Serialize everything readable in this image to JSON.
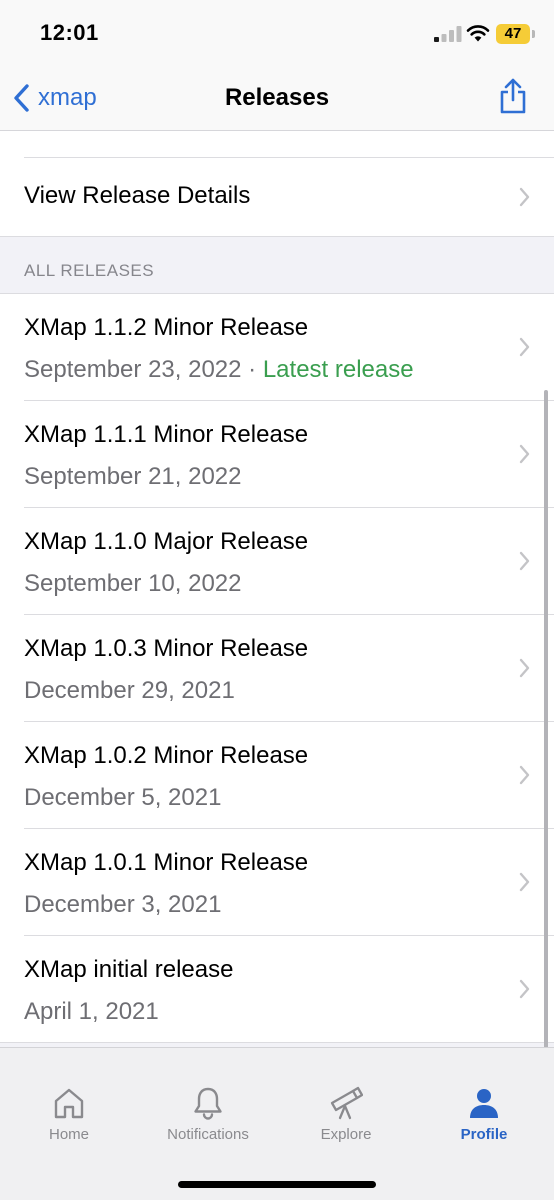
{
  "status_bar": {
    "time": "12:01",
    "battery": "47"
  },
  "nav": {
    "back_label": "xmap",
    "title": "Releases"
  },
  "details_row": {
    "label": "View Release Details"
  },
  "section": {
    "label": "ALL RELEASES"
  },
  "releases": [
    {
      "title": "XMap 1.1.2 Minor Release",
      "date": "September 23, 2022",
      "separator": " · ",
      "badge": "Latest release"
    },
    {
      "title": "XMap 1.1.1 Minor Release",
      "date": "September 21, 2022"
    },
    {
      "title": "XMap 1.1.0 Major Release",
      "date": "September 10, 2022"
    },
    {
      "title": "XMap 1.0.3 Minor Release",
      "date": "December 29, 2021"
    },
    {
      "title": "XMap 1.0.2 Minor Release",
      "date": "December 5, 2021"
    },
    {
      "title": "XMap 1.0.1 Minor Release",
      "date": "December 3, 2021"
    },
    {
      "title": "XMap initial release",
      "date": "April 1, 2021"
    }
  ],
  "tabs": [
    {
      "label": "Home",
      "icon": "home-icon"
    },
    {
      "label": "Notifications",
      "icon": "bell-icon"
    },
    {
      "label": "Explore",
      "icon": "telescope-icon"
    },
    {
      "label": "Profile",
      "icon": "person-icon"
    }
  ],
  "colors": {
    "accent": "#2f6fd4",
    "latest": "#3a9e4f",
    "battery": "#f5cc37"
  }
}
